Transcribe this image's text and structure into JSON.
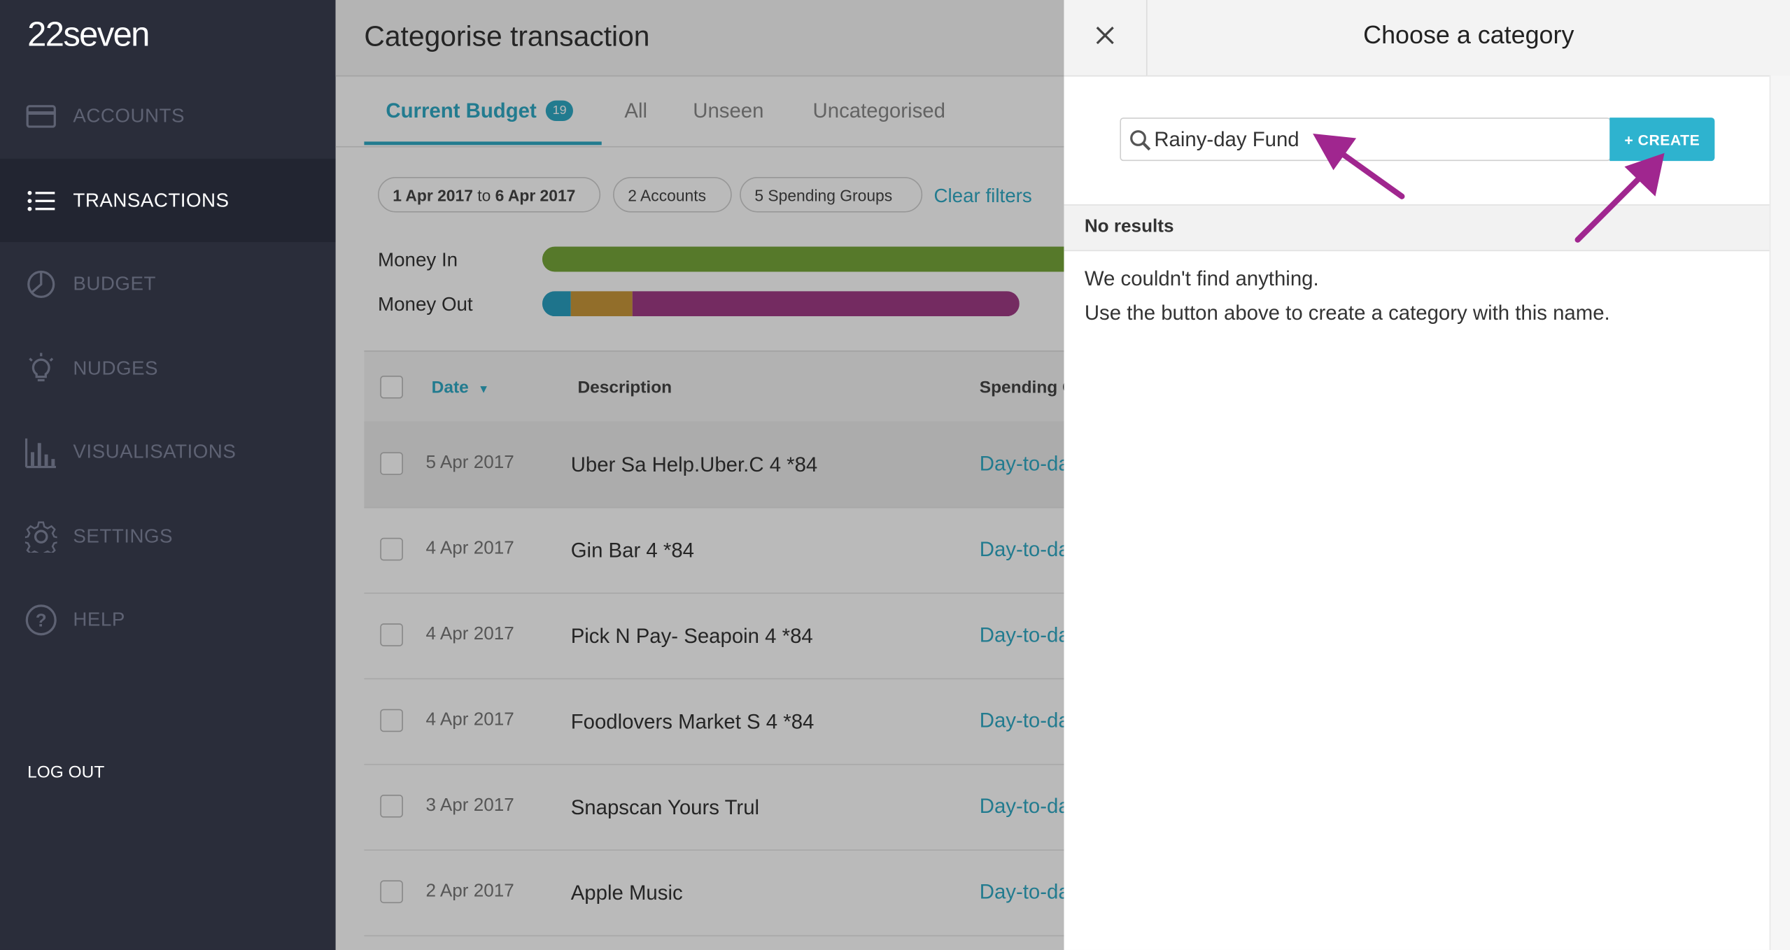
{
  "app": {
    "logo": "22seven"
  },
  "sidebar": {
    "items": [
      {
        "label": "ACCOUNTS",
        "icon": "card-icon"
      },
      {
        "label": "TRANSACTIONS",
        "icon": "list-icon",
        "active": true
      },
      {
        "label": "BUDGET",
        "icon": "pie-chart-icon"
      },
      {
        "label": "NUDGES",
        "icon": "lightbulb-icon"
      },
      {
        "label": "VISUALISATIONS",
        "icon": "bar-chart-icon"
      },
      {
        "label": "SETTINGS",
        "icon": "gear-icon"
      },
      {
        "label": "HELP",
        "icon": "help-icon"
      }
    ],
    "logout": "LOG OUT"
  },
  "main": {
    "title": "Categorise transaction",
    "tabs": [
      {
        "label": "Current Budget",
        "badge": "19",
        "active": true
      },
      {
        "label": "All"
      },
      {
        "label": "Unseen"
      },
      {
        "label": "Uncategorised"
      }
    ],
    "filters": {
      "date_from": "1 Apr 2017",
      "date_to_word": "to",
      "date_to": "6 Apr 2017",
      "accounts": "2 Accounts",
      "groups": "5 Spending Groups",
      "clear": "Clear filters"
    },
    "money": {
      "in_label": "Money In",
      "out_label": "Money Out",
      "in_color": "#76a63a",
      "out_colors": [
        "#2a9fc0",
        "#c8973a",
        "#a03b86"
      ]
    },
    "table": {
      "headers": {
        "date": "Date",
        "description": "Description",
        "group": "Spending G"
      },
      "rows": [
        {
          "date": "5 Apr 2017",
          "description": "Uber Sa Help.Uber.C 4 *84",
          "group": "Day-to-day"
        },
        {
          "date": "4 Apr 2017",
          "description": "Gin Bar 4 *84",
          "group": "Day-to-day"
        },
        {
          "date": "4 Apr 2017",
          "description": "Pick N Pay- Seapoin 4 *84",
          "group": "Day-to-day"
        },
        {
          "date": "4 Apr 2017",
          "description": "Foodlovers Market S 4 *84",
          "group": "Day-to-day"
        },
        {
          "date": "3 Apr 2017",
          "description": "Snapscan Yours Trul",
          "group": "Day-to-day"
        },
        {
          "date": "2 Apr 2017",
          "description": "Apple Music",
          "group": "Day-to-day"
        }
      ]
    }
  },
  "panel": {
    "title": "Choose a category",
    "search_value": "Rainy-day Fund",
    "create_label": "+ CREATE",
    "results_header": "No results",
    "empty_line1": "We couldn't find anything.",
    "empty_line2": "Use the button above to create a category with this name.",
    "arrow_color": "#a0268f"
  }
}
